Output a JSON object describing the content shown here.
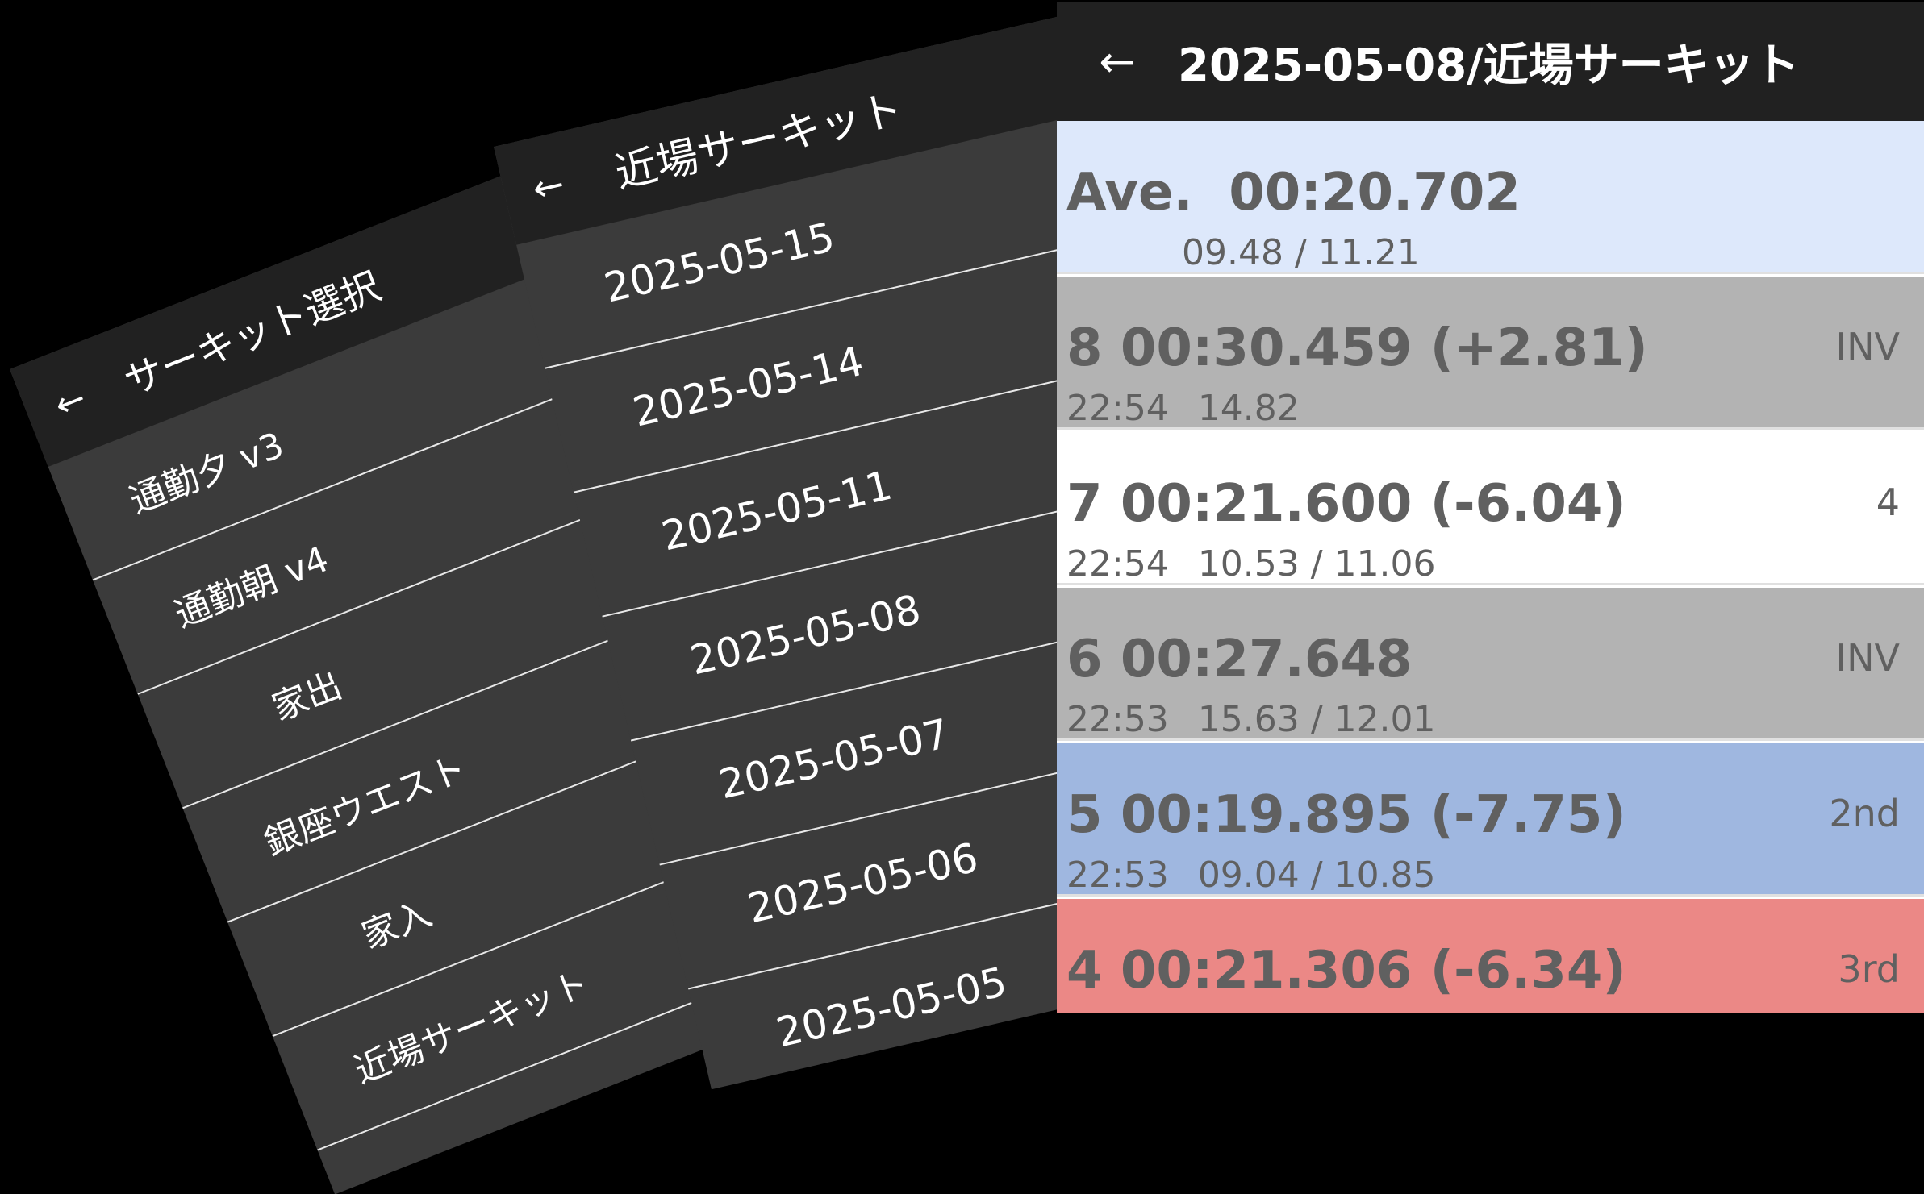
{
  "screen1": {
    "back_icon": "arrow-left-icon",
    "title": "サーキット選択",
    "items": [
      "通勤夕 v3",
      "通勤朝 v4",
      "家出",
      "銀座ウエスト",
      "家入",
      "近場サーキット"
    ]
  },
  "screen2": {
    "back_icon": "arrow-left-icon",
    "title": "近場サーキット",
    "items": [
      "2025-05-15",
      "2025-05-14",
      "2025-05-11",
      "2025-05-08",
      "2025-05-07",
      "2025-05-06",
      "2025-05-05"
    ]
  },
  "screen3": {
    "back_icon": "arrow-left-icon",
    "title": "2025-05-08/近場サーキット",
    "average": {
      "label": "Ave.",
      "time": "00:20.702",
      "splits": "09.48 / 11.21",
      "color": "#dde8fb"
    },
    "laps": [
      {
        "main": "8 00:30.459 (+2.81)",
        "clock": "22:54",
        "splits": "14.82",
        "tag": "INV",
        "color": "#b3b3b3"
      },
      {
        "main": "7 00:21.600 (-6.04)",
        "clock": "22:54",
        "splits": "10.53 / 11.06",
        "tag": "4",
        "color": "#ffffff"
      },
      {
        "main": "6 00:27.648",
        "clock": "22:53",
        "splits": "15.63 / 12.01",
        "tag": "INV",
        "color": "#b3b3b3"
      },
      {
        "main": "5 00:19.895 (-7.75)",
        "clock": "22:53",
        "splits": "09.04 / 10.85",
        "tag": "2nd",
        "color": "#9fb7e0"
      },
      {
        "main": "4 00:21.306 (-6.34)",
        "clock": "",
        "splits": "",
        "tag": "3rd",
        "color": "#eb8886"
      }
    ]
  }
}
